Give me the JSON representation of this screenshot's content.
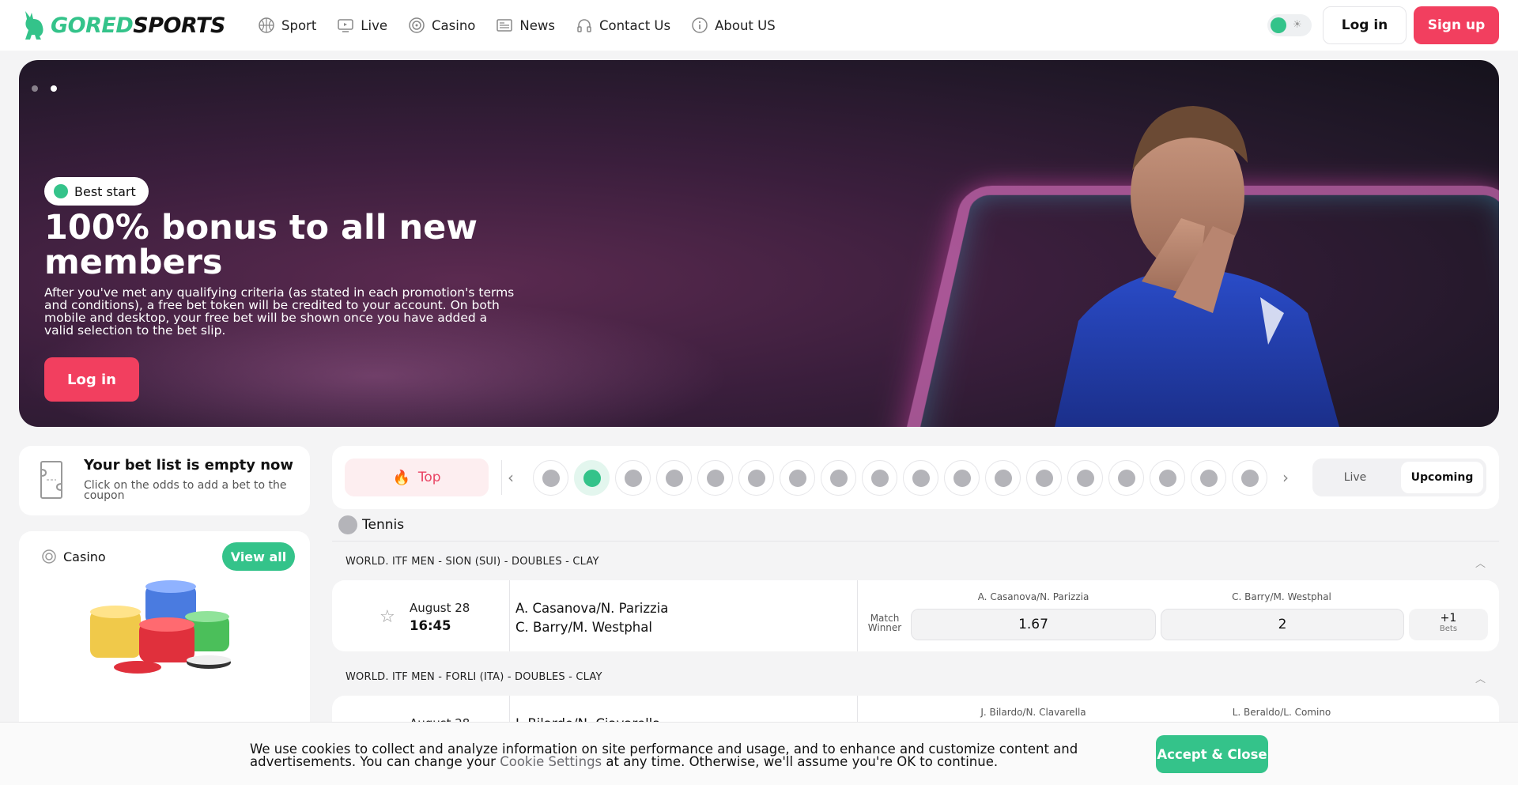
{
  "header": {
    "logo_part1": "GORED",
    "logo_part2": "SPORTS",
    "nav": [
      {
        "label": "Sport",
        "icon": "basketball-icon"
      },
      {
        "label": "Live",
        "icon": "tv-icon"
      },
      {
        "label": "Casino",
        "icon": "casino-chip-icon"
      },
      {
        "label": "News",
        "icon": "newspaper-icon"
      },
      {
        "label": "Contact Us",
        "icon": "headset-icon"
      },
      {
        "label": "About US",
        "icon": "info-icon"
      }
    ],
    "login_label": "Log in",
    "signup_label": "Sign up"
  },
  "hero": {
    "badge": "Best start",
    "title": "100% bonus to all new members",
    "description": "After you've met any qualifying criteria (as stated in each promotion's terms and conditions), a free bet token will be credited to your account. On both mobile and desktop, your free bet will be shown once you have added a valid selection to the bet slip.",
    "button": "Log in"
  },
  "betslip": {
    "title": "Your bet list is empty now",
    "subtitle": "Click on the odds to add a bet to the coupon"
  },
  "casino_card": {
    "title": "Casino",
    "button": "View all"
  },
  "sportbar": {
    "top_label": "Top",
    "live_label": "Live",
    "upcoming_label": "Upcoming"
  },
  "section": {
    "sport": "Tennis",
    "leagues": [
      {
        "name": "WORLD. ITF MEN - SION (SUI) - DOUBLES - CLAY",
        "match": {
          "date": "August 28",
          "time": "16:45",
          "team1": "A. Casanova/N. Parizzia",
          "team2": "C. Barry/M. Westphal",
          "market": "Match Winner",
          "odds1_label": "A. Casanova/N. Parizzia",
          "odds2_label": "C. Barry/M. Westphal",
          "odds1": "1.67",
          "odds2": "2",
          "more": "+1",
          "more_label": "Bets"
        }
      },
      {
        "name": "WORLD. ITF MEN - FORLI (ITA) - DOUBLES - CLAY",
        "match": {
          "date": "August 28",
          "team1": "J. Bilardo/N. Ciavarella",
          "odds1_label": "J. Bilardo/N. Clavarella",
          "odds2_label": "L. Beraldo/L. Comino"
        }
      }
    ]
  },
  "cookie": {
    "text_before": "We use cookies to collect and analyze information on site performance and usage, and to enhance and customize content and advertisements. You can change your ",
    "link": "Cookie Settings",
    "text_after": " at any time. Otherwise, we'll assume you're OK to continue.",
    "button": "Accept & Close"
  },
  "colors": {
    "brand_green": "#34c38a",
    "brand_red": "#f23f5f"
  }
}
